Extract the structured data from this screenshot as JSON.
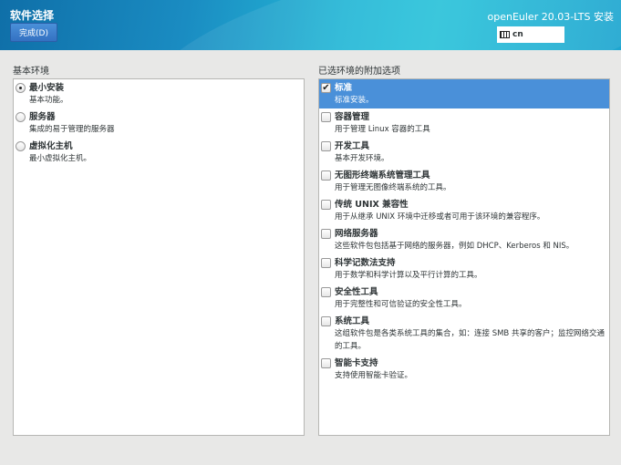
{
  "header": {
    "title": "软件选择",
    "done_button": "完成(D)",
    "product": "openEuler 20.03-LTS 安装",
    "keyboard_layout": "cn"
  },
  "base_env": {
    "label": "基本环境",
    "items": [
      {
        "title": "最小安装",
        "desc": "基本功能。",
        "selected": true
      },
      {
        "title": "服务器",
        "desc": "集成的易于管理的服务器",
        "selected": false
      },
      {
        "title": "虚拟化主机",
        "desc": "最小虚拟化主机。",
        "selected": false
      }
    ]
  },
  "addons": {
    "label": "已选环境的附加选项",
    "items": [
      {
        "title": "标准",
        "desc": "标准安装。",
        "checked": true
      },
      {
        "title": "容器管理",
        "desc": "用于管理 Linux 容器的工具",
        "checked": false
      },
      {
        "title": "开发工具",
        "desc": "基本开发环境。",
        "checked": false
      },
      {
        "title": "无图形终端系统管理工具",
        "desc": "用于管理无图像终端系统的工具。",
        "checked": false
      },
      {
        "title": "传统 UNIX 兼容性",
        "desc": "用于从继承 UNIX 环境中迁移或者可用于该环境的兼容程序。",
        "checked": false
      },
      {
        "title": "网络服务器",
        "desc": "这些软件包包括基于网络的服务器，例如 DHCP、Kerberos 和 NIS。",
        "checked": false
      },
      {
        "title": "科学记数法支持",
        "desc": "用于数学和科学计算以及平行计算的工具。",
        "checked": false
      },
      {
        "title": "安全性工具",
        "desc": "用于完整性和可信验证的安全性工具。",
        "checked": false
      },
      {
        "title": "系统工具",
        "desc": "这组软件包是各类系统工具的集合，如：连接 SMB 共享的客户；监控网络交通的工具。",
        "checked": false
      },
      {
        "title": "智能卡支持",
        "desc": "支持使用智能卡验证。",
        "checked": false
      }
    ]
  }
}
